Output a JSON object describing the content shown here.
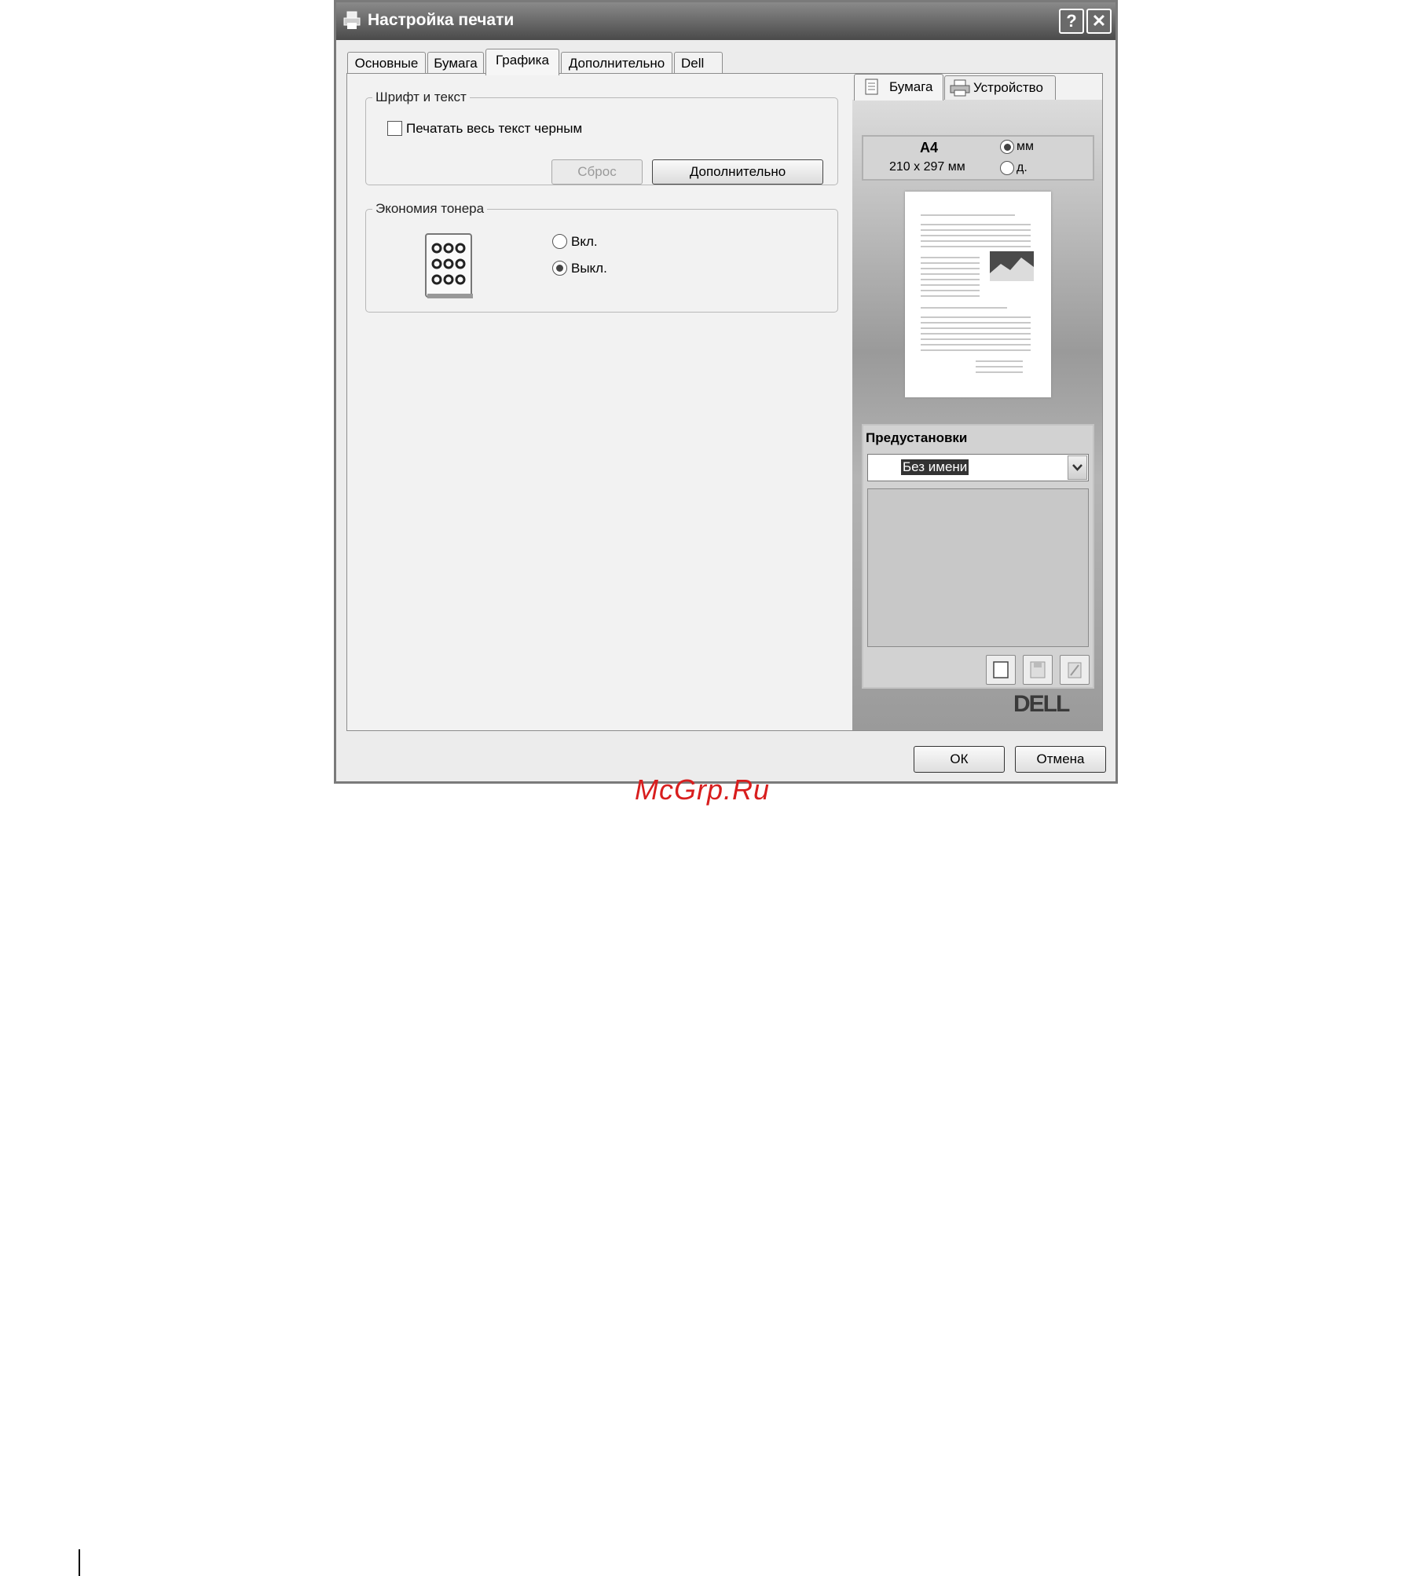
{
  "window": {
    "title": "Настройка печати",
    "help_label": "?",
    "close_label": "✕"
  },
  "tabs": [
    {
      "label": "Основные",
      "active": false
    },
    {
      "label": "Бумага",
      "active": false
    },
    {
      "label": "Графика",
      "active": true
    },
    {
      "label": "Дополнительно",
      "active": false
    },
    {
      "label": "Dell",
      "active": false
    }
  ],
  "font_text_group": {
    "legend": "Шрифт и текст",
    "checkbox_label": "Печатать весь текст черным",
    "checkbox_checked": false,
    "reset_button": "Сброс",
    "advanced_button": "Дополнительно"
  },
  "toner_group": {
    "legend": "Экономия тонера",
    "options": [
      {
        "label": "Вкл.",
        "selected": false
      },
      {
        "label": "Выкл.",
        "selected": true
      }
    ]
  },
  "preview_panel": {
    "tabs": [
      {
        "label": "Бумага",
        "active": true
      },
      {
        "label": "Устройство",
        "active": false
      }
    ],
    "paper_size": "A4",
    "paper_dimensions": "210 x 297 мм",
    "units": [
      {
        "label": "мм",
        "selected": true
      },
      {
        "label": "д.",
        "selected": false
      }
    ],
    "presets_label": "Предустановки",
    "preset_value": "Без имени",
    "brand": "DELL"
  },
  "footer": {
    "ok": "ОК",
    "cancel": "Отмена"
  },
  "watermark": "McGrp.Ru"
}
